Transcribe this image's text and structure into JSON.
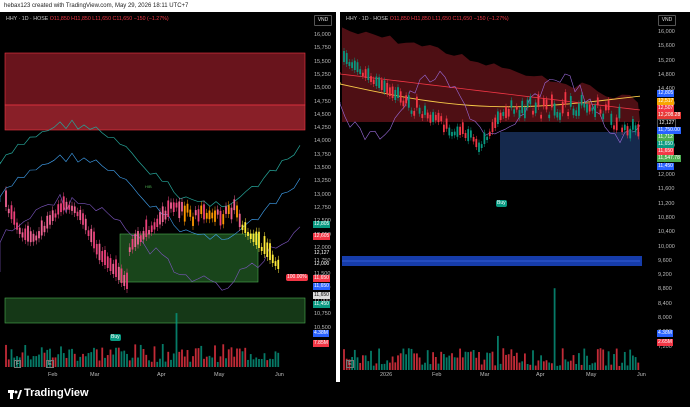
{
  "header": {
    "text": "hebax123 created with TradingView.com, May 29, 2026 18:11 UTC+7"
  },
  "left_chart": {
    "legend_prefix": "HHY · 1D · HOSE",
    "ohlc": "O11,850 H11,850 L11,650 C11,650 −150 (−1.27%)",
    "currency": "VND",
    "price_labels": [
      {
        "text": "12,805",
        "color": "#089981"
      },
      {
        "text": "12,605",
        "color": "#f23645"
      },
      {
        "text": "12,127",
        "color": "#000000"
      },
      {
        "text": "12,000",
        "color": "#000000"
      },
      {
        "text": "11,650",
        "color": "#f23645"
      },
      {
        "text": "11,650",
        "color": "#2962ff"
      },
      {
        "text": "11,650",
        "color": "#cccccc"
      },
      {
        "text": "11,450",
        "color": "#089981"
      },
      {
        "text": "4.38M",
        "color": "#2962ff"
      },
      {
        "text": "7.85M",
        "color": "#f23645"
      }
    ],
    "callout": "100.00%",
    "buy_label": "Buy",
    "box_label": "HIB",
    "x_labels": [
      "Feb",
      "Mar",
      "Apr",
      "May",
      "Jun"
    ],
    "left_ticks": [
      "F",
      "E"
    ]
  },
  "right_chart": {
    "legend_prefix": "HHY · 1D · HOSE",
    "ohlc": "O11,850 H11,850 L11,650 C11,650 −150 (−1.27%)",
    "currency": "VND",
    "y_ticks": [
      "16,000",
      "15,600",
      "15,200",
      "14,800",
      "14,400",
      "14,000",
      "13,600",
      "13,200",
      "12,800",
      "12,400",
      "12,000",
      "11,600",
      "11,200",
      "10,800",
      "10,400",
      "10,000",
      "9,600",
      "9,200",
      "8,800",
      "8,400",
      "8,000",
      "7,600",
      "7,200"
    ],
    "price_labels": [
      {
        "text": "12,805",
        "color": "#2962ff"
      },
      {
        "text": "12,517",
        "color": "#f7a600"
      },
      {
        "text": "12,507",
        "color": "#f23645"
      },
      {
        "text": "12,208.28",
        "color": "#e53935"
      },
      {
        "text": "12,127",
        "color": "#000000"
      },
      {
        "text": "11,750.00",
        "color": "#2962ff"
      },
      {
        "text": "11,712",
        "color": "#4caf50"
      },
      {
        "text": "11,650",
        "color": "#089981"
      },
      {
        "text": "11,650",
        "color": "#f23645"
      },
      {
        "text": "11,547.78",
        "color": "#4caf50"
      },
      {
        "text": "11,450",
        "color": "#2962ff"
      },
      {
        "text": "4.38M",
        "color": "#2962ff"
      },
      {
        "text": "2.65M",
        "color": "#f23645"
      }
    ],
    "buy_label": "Buy",
    "x_labels": [
      "2026",
      "Feb",
      "Mar",
      "Apr",
      "May",
      "Jun"
    ],
    "left_ticks": [
      "E"
    ]
  },
  "left_y_ticks": [
    "16,000",
    "15,750",
    "15,500",
    "15,250",
    "15,000",
    "14,750",
    "14,500",
    "14,250",
    "14,000",
    "13,750",
    "13,500",
    "13,250",
    "13,000",
    "12,750",
    "12,500",
    "12,250",
    "12,000",
    "11,750",
    "11,500",
    "11,250",
    "11,000",
    "10,750",
    "10,500"
  ],
  "footer": {
    "brand": "TradingView"
  }
}
